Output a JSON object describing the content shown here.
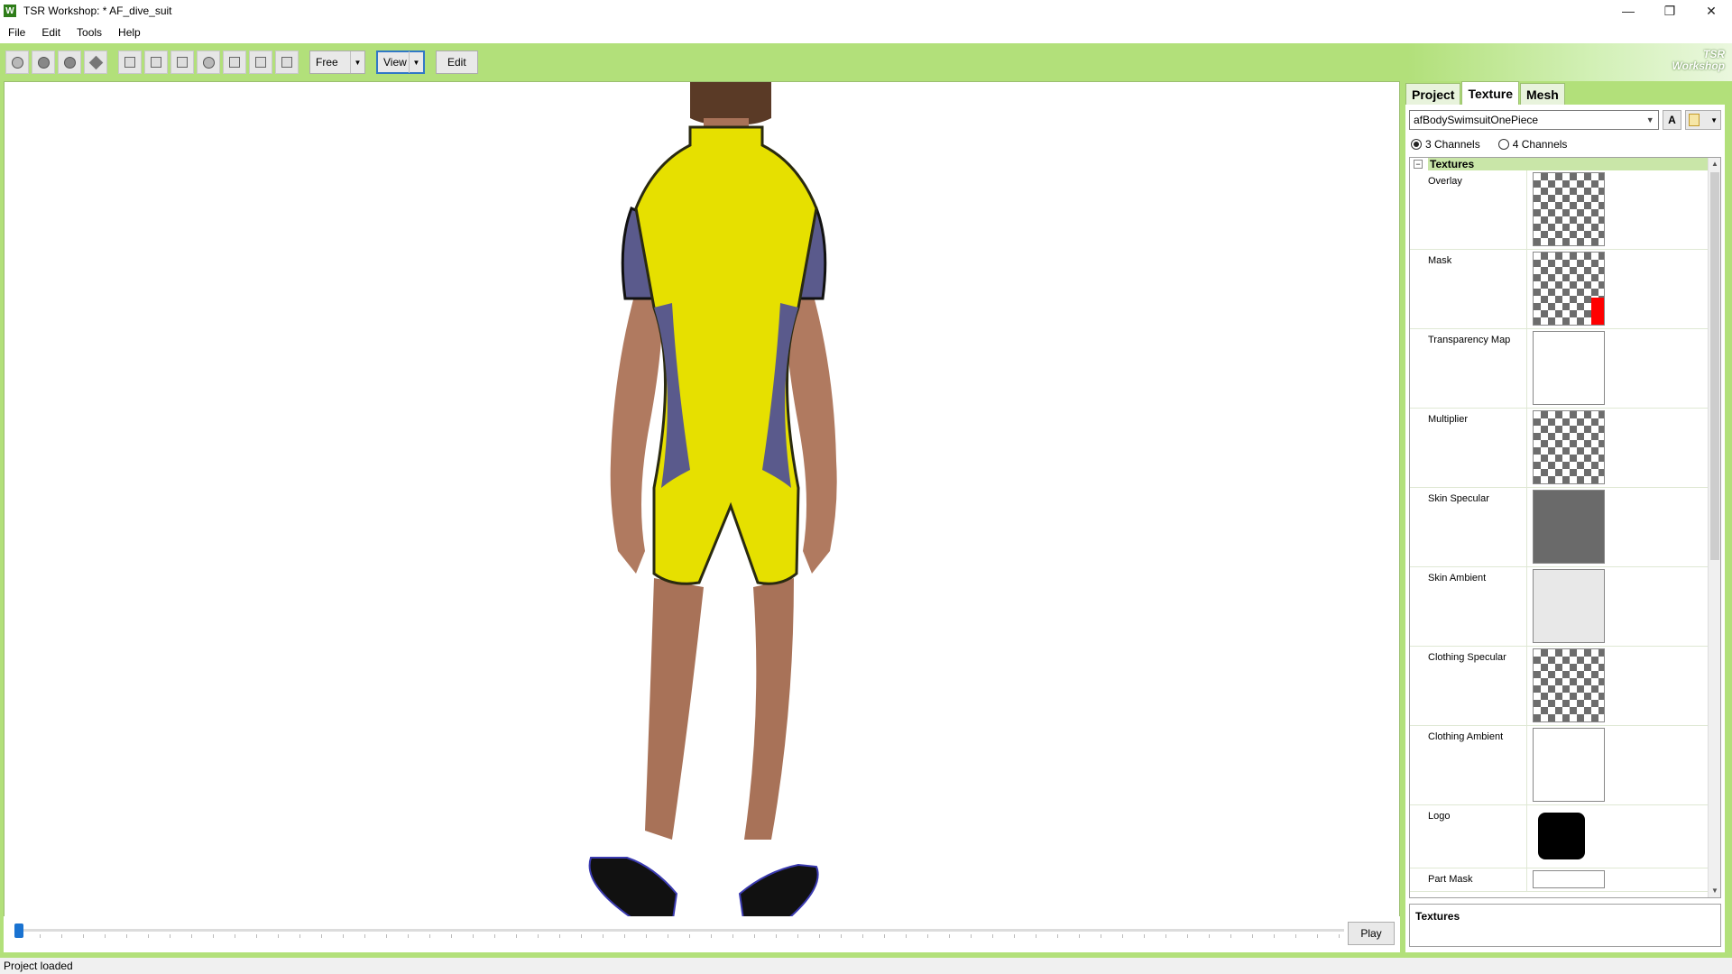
{
  "window": {
    "title": "TSR Workshop: * AF_dive_suit",
    "app_icon": "W",
    "controls": {
      "minimize": "—",
      "restore": "❐",
      "close": "✕"
    }
  },
  "menu": [
    "File",
    "Edit",
    "Tools",
    "Help"
  ],
  "toolbar": {
    "camera_mode": "Free",
    "view_label": "View",
    "edit_label": "Edit"
  },
  "brand": {
    "line1": "TSR",
    "line2": "Workshop"
  },
  "timeline": {
    "play_label": "Play"
  },
  "panel": {
    "tabs": [
      {
        "label": "Project",
        "active": false
      },
      {
        "label": "Texture",
        "active": true
      },
      {
        "label": "Mesh",
        "active": false
      }
    ],
    "texture_selector": "afBodySwimsuitOnePiece",
    "auto_button": "A",
    "channels": [
      {
        "label": "3 Channels",
        "selected": true
      },
      {
        "label": "4 Channels",
        "selected": false
      }
    ],
    "section_title": "Textures",
    "section_toggle": "−",
    "textures": [
      {
        "label": "Overlay",
        "preview": "checker"
      },
      {
        "label": "Mask",
        "preview": "checker-red"
      },
      {
        "label": "Transparency Map",
        "preview": "white"
      },
      {
        "label": "Multiplier",
        "preview": "checker"
      },
      {
        "label": "Skin Specular",
        "preview": "dark-body"
      },
      {
        "label": "Skin Ambient",
        "preview": "light-body"
      },
      {
        "label": "Clothing Specular",
        "preview": "checker"
      },
      {
        "label": "Clothing Ambient",
        "preview": "white"
      },
      {
        "label": "Logo",
        "preview": "black-rounded"
      },
      {
        "label": "Part Mask",
        "preview": "white"
      }
    ],
    "description_title": "Textures"
  },
  "status": "Project loaded",
  "colors": {
    "accent_green": "#b2e07a",
    "section_green": "#c9e6a8",
    "suit_yellow": "#e6e000",
    "suit_purple": "#5a5a8c",
    "skin": "#b07a60",
    "focus_blue": "#3178c6"
  }
}
